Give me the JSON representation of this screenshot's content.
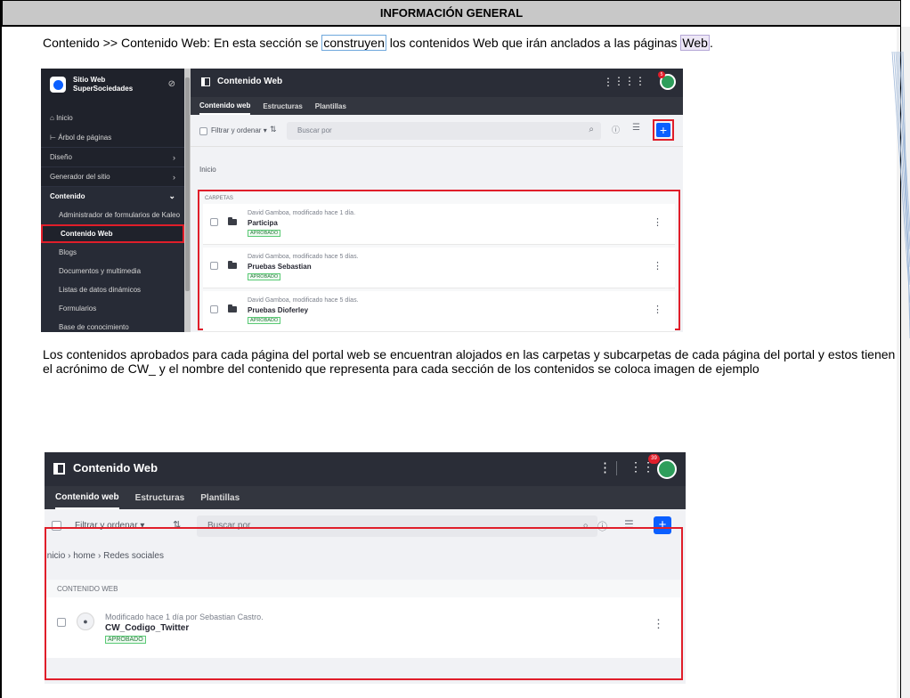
{
  "document": {
    "header_title": "INFORMACIÓN GENERAL",
    "paragraph1": {
      "part1": "Contenido >> Contenido Web: En esta sección se ",
      "highlight1": "construyen",
      "part2": " los contenidos Web que irán anclados a las páginas ",
      "highlight2": "Web",
      "part3": "."
    },
    "paragraph2": "Los contenidos aprobados para cada página del portal web se encuentran alojados en las carpetas y subcarpetas de cada página del portal y estos tienen el acrónimo de CW_ y el nombre del contenido que representa para cada sección de los contenidos se coloca imagen de ejemplo"
  },
  "screenshot1": {
    "site_name_line1": "Sitio Web",
    "site_name_line2": "SuperSociedades",
    "nav": {
      "inicio": "Inicio",
      "arbol": "Árbol de páginas",
      "diseno": "Diseño",
      "generador": "Generador del sitio",
      "contenido": "Contenido",
      "sub_items": [
        "Administrador de formularios de Kaleo",
        "Contenido Web",
        "Blogs",
        "Documentos y multimedia",
        "Listas de datos dinámicos",
        "Formularios",
        "Base de conocimiento"
      ]
    },
    "title": "Contenido Web",
    "notification_count": "5",
    "tabs": [
      "Contenido web",
      "Estructuras",
      "Plantillas"
    ],
    "filter_label": "Filtrar y ordenar",
    "search_placeholder": "Buscar por",
    "breadcrumb": "Inicio",
    "section_label": "CARPETAS",
    "folders": [
      {
        "meta": "David Gamboa, modificado hace 1 día.",
        "name": "Participa",
        "status": "APROBADO"
      },
      {
        "meta": "David Gamboa, modificado hace 5 días.",
        "name": "Pruebas Sebastian",
        "status": "APROBADO"
      },
      {
        "meta": "David Gamboa, modificado hace 5 días.",
        "name": "Pruebas Dioferley",
        "status": "APROBADO"
      }
    ],
    "colors": {
      "accent": "#0b5fff",
      "highlight_border": "#e01e2a",
      "sidebar_bg": "#1f222b"
    }
  },
  "screenshot2": {
    "title": "Contenido Web",
    "notification_count": "39",
    "tabs": [
      "Contenido web",
      "Estructuras",
      "Plantillas"
    ],
    "filter_label": "Filtrar y ordenar",
    "search_placeholder": "Buscar por",
    "breadcrumb": "Inicio  ›  home  ›  Redes sociales",
    "section_label": "CONTENIDO WEB",
    "item": {
      "meta": "Modificado hace 1 día por Sebastian Castro.",
      "name": "CW_Codigo_Twitter",
      "status": "APROBADO"
    }
  },
  "icons": [
    "compass-icon",
    "home-icon",
    "tree-icon",
    "chevron-right-icon",
    "chevron-down-icon",
    "panel-icon",
    "kebab-icon",
    "apps-grid-icon",
    "avatar-icon",
    "sort-icon",
    "search-icon",
    "info-icon",
    "list-view-icon",
    "add-icon",
    "folder-icon",
    "user-icon"
  ]
}
